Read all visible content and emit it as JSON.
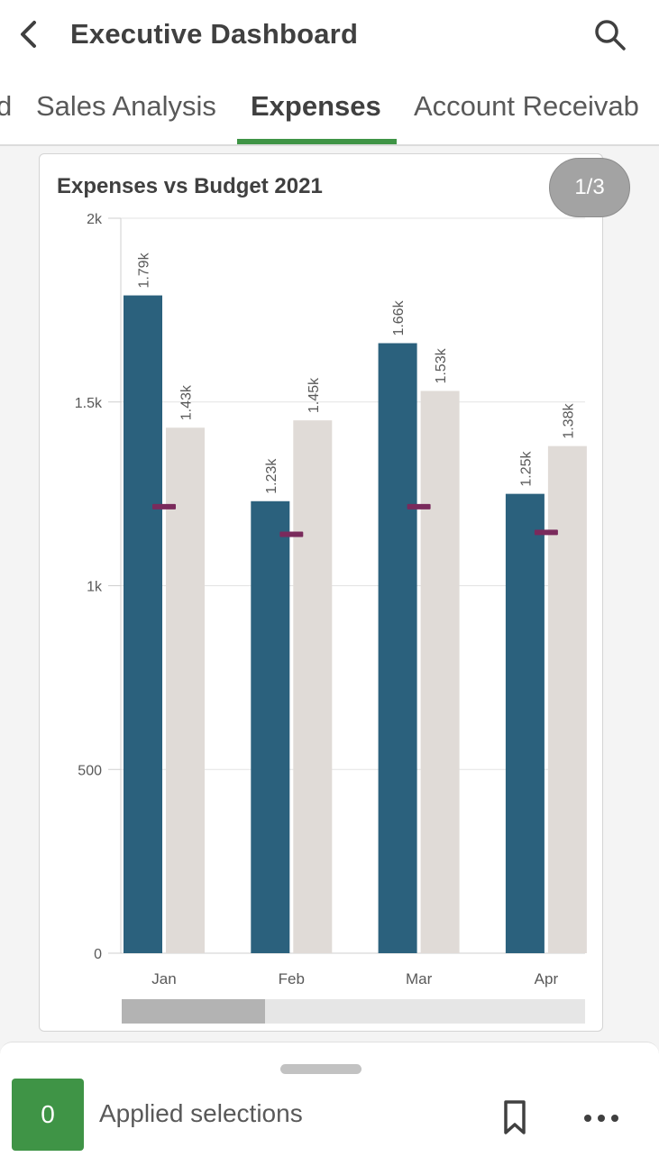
{
  "header": {
    "title": "Executive Dashboard",
    "back_icon": "chevron-left-icon",
    "search_icon": "search-icon"
  },
  "tabs": [
    {
      "label": "d",
      "active": false
    },
    {
      "label": "Sales Analysis",
      "active": false
    },
    {
      "label": "Expenses",
      "active": true
    },
    {
      "label": "Account Receivab",
      "active": false
    }
  ],
  "card": {
    "title": "Expenses vs Budget 2021",
    "page_indicator": "1/3"
  },
  "chart_data": {
    "type": "bar",
    "title": "Expenses vs Budget 2021",
    "categories": [
      "Jan",
      "Feb",
      "Mar",
      "Apr"
    ],
    "ylim": [
      0,
      2000
    ],
    "yticks": [
      0,
      500,
      1000,
      1500,
      2000
    ],
    "ytick_labels": [
      "0",
      "500",
      "1k",
      "1.5k",
      "2k"
    ],
    "grid": true,
    "series": [
      {
        "values": [
          1790,
          1230,
          1660,
          1250
        ],
        "labels": [
          "1.79k",
          "1.23k",
          "1.66k",
          "1.25k"
        ],
        "color": "#2b617d"
      },
      {
        "values": [
          1430,
          1450,
          1530,
          1380
        ],
        "labels": [
          "1.43k",
          "1.45k",
          "1.53k",
          "1.38k"
        ],
        "color": "#e0dbd7"
      }
    ],
    "markers": {
      "values": [
        1215,
        1140,
        1215,
        1145
      ],
      "color": "#7a2a5c"
    }
  },
  "scrollbar": {
    "position_fraction": 0,
    "visible_fraction": 0.31
  },
  "bottom_bar": {
    "selection_count": "0",
    "selection_label": "Applied selections",
    "bookmark_icon": "bookmark-icon",
    "more_icon": "more-horizontal-icon"
  },
  "colors": {
    "accent": "#3f9446",
    "expense_bar": "#2b617d",
    "budget_bar": "#e0dbd7",
    "marker": "#7a2a5c"
  }
}
